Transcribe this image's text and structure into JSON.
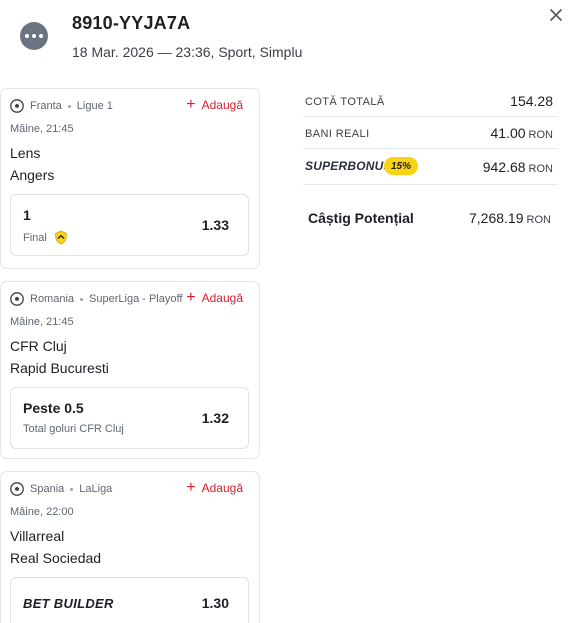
{
  "ticket": {
    "id": "8910-YYJA7A",
    "meta": "18 Mar. 2026 — 23:36, Sport, Simplu"
  },
  "events": [
    {
      "country": "Franta",
      "league": "Ligue 1",
      "add_label": "Adaugă",
      "time": "Mâine, 21:45",
      "home": "Lens",
      "away": "Angers",
      "selection": "1",
      "market": "Final",
      "odd": "1.33"
    },
    {
      "country": "Romania",
      "league": "SuperLiga - Playoff",
      "add_label": "Adaugă",
      "time": "Mâine, 21:45",
      "home": "CFR Cluj",
      "away": "Rapid Bucuresti",
      "selection": "Peste 0.5",
      "market": "Total goluri CFR Cluj",
      "odd": "1.32"
    },
    {
      "country": "Spania",
      "league": "LaLiga",
      "add_label": "Adaugă",
      "time": "Mâine, 22:00",
      "home": "Villarreal",
      "away": "Real Sociedad",
      "selection": "BET BUILDER",
      "odd": "1.30"
    }
  ],
  "summary": {
    "total_odds_label": "COTĂ TOTALĂ",
    "total_odds": "154.28",
    "real_money_label": "BANI REALI",
    "real_money": "41.00",
    "superbonus_label": "SUPERBONUS",
    "superbonus_pct": "15%",
    "superbonus_value": "942.68",
    "potential_win_label": "Câștig Potențial",
    "potential_win": "7,268.19",
    "currency": "RON"
  },
  "colors": {
    "accent_red": "#d81e2c",
    "bonus_yellow": "#fad313"
  },
  "icons": {
    "menu": "more-dots-icon",
    "close": "close-icon",
    "sport": "football-icon",
    "add": "plus-icon",
    "badge": "shield-badge-icon"
  }
}
